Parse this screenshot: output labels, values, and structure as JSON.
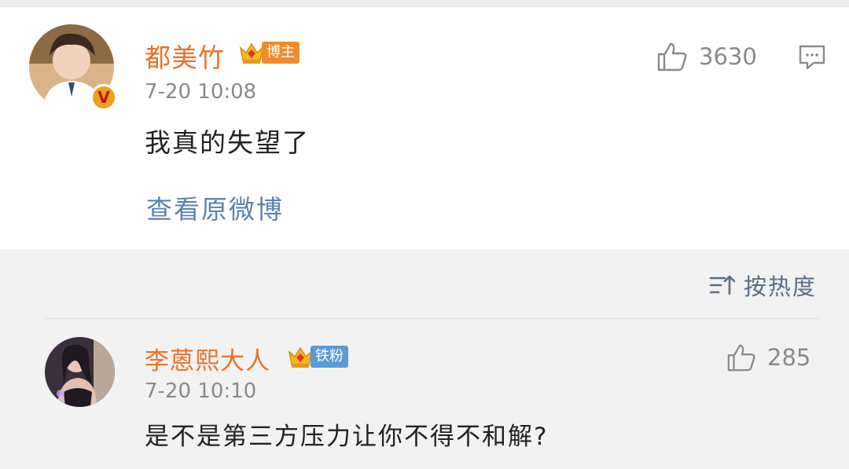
{
  "post": {
    "author": "都美竹",
    "badge_label": "博主",
    "verified_mark": "V",
    "time": "7-20 10:08",
    "content": "我真的失望了",
    "like_count": "3630",
    "view_original": "查看原微博",
    "icons": [
      "thumbs-up-icon",
      "comment-icon",
      "crown-icon",
      "verified-icon"
    ]
  },
  "sort": {
    "label": "按热度",
    "icon": "sort-icon"
  },
  "comment": {
    "author": "李蒽熙大人",
    "badge_label": "铁粉",
    "time": "7-20 10:10",
    "content": "是不是第三方压力让你不得不和解?",
    "like_count": "285"
  },
  "colors": {
    "author_name": "#eb7226",
    "blogger_tag": "#f08b2c",
    "fan_tag": "#5b9bd5",
    "link": "#5b84ad",
    "meta_gray": "#8a8a8a"
  }
}
